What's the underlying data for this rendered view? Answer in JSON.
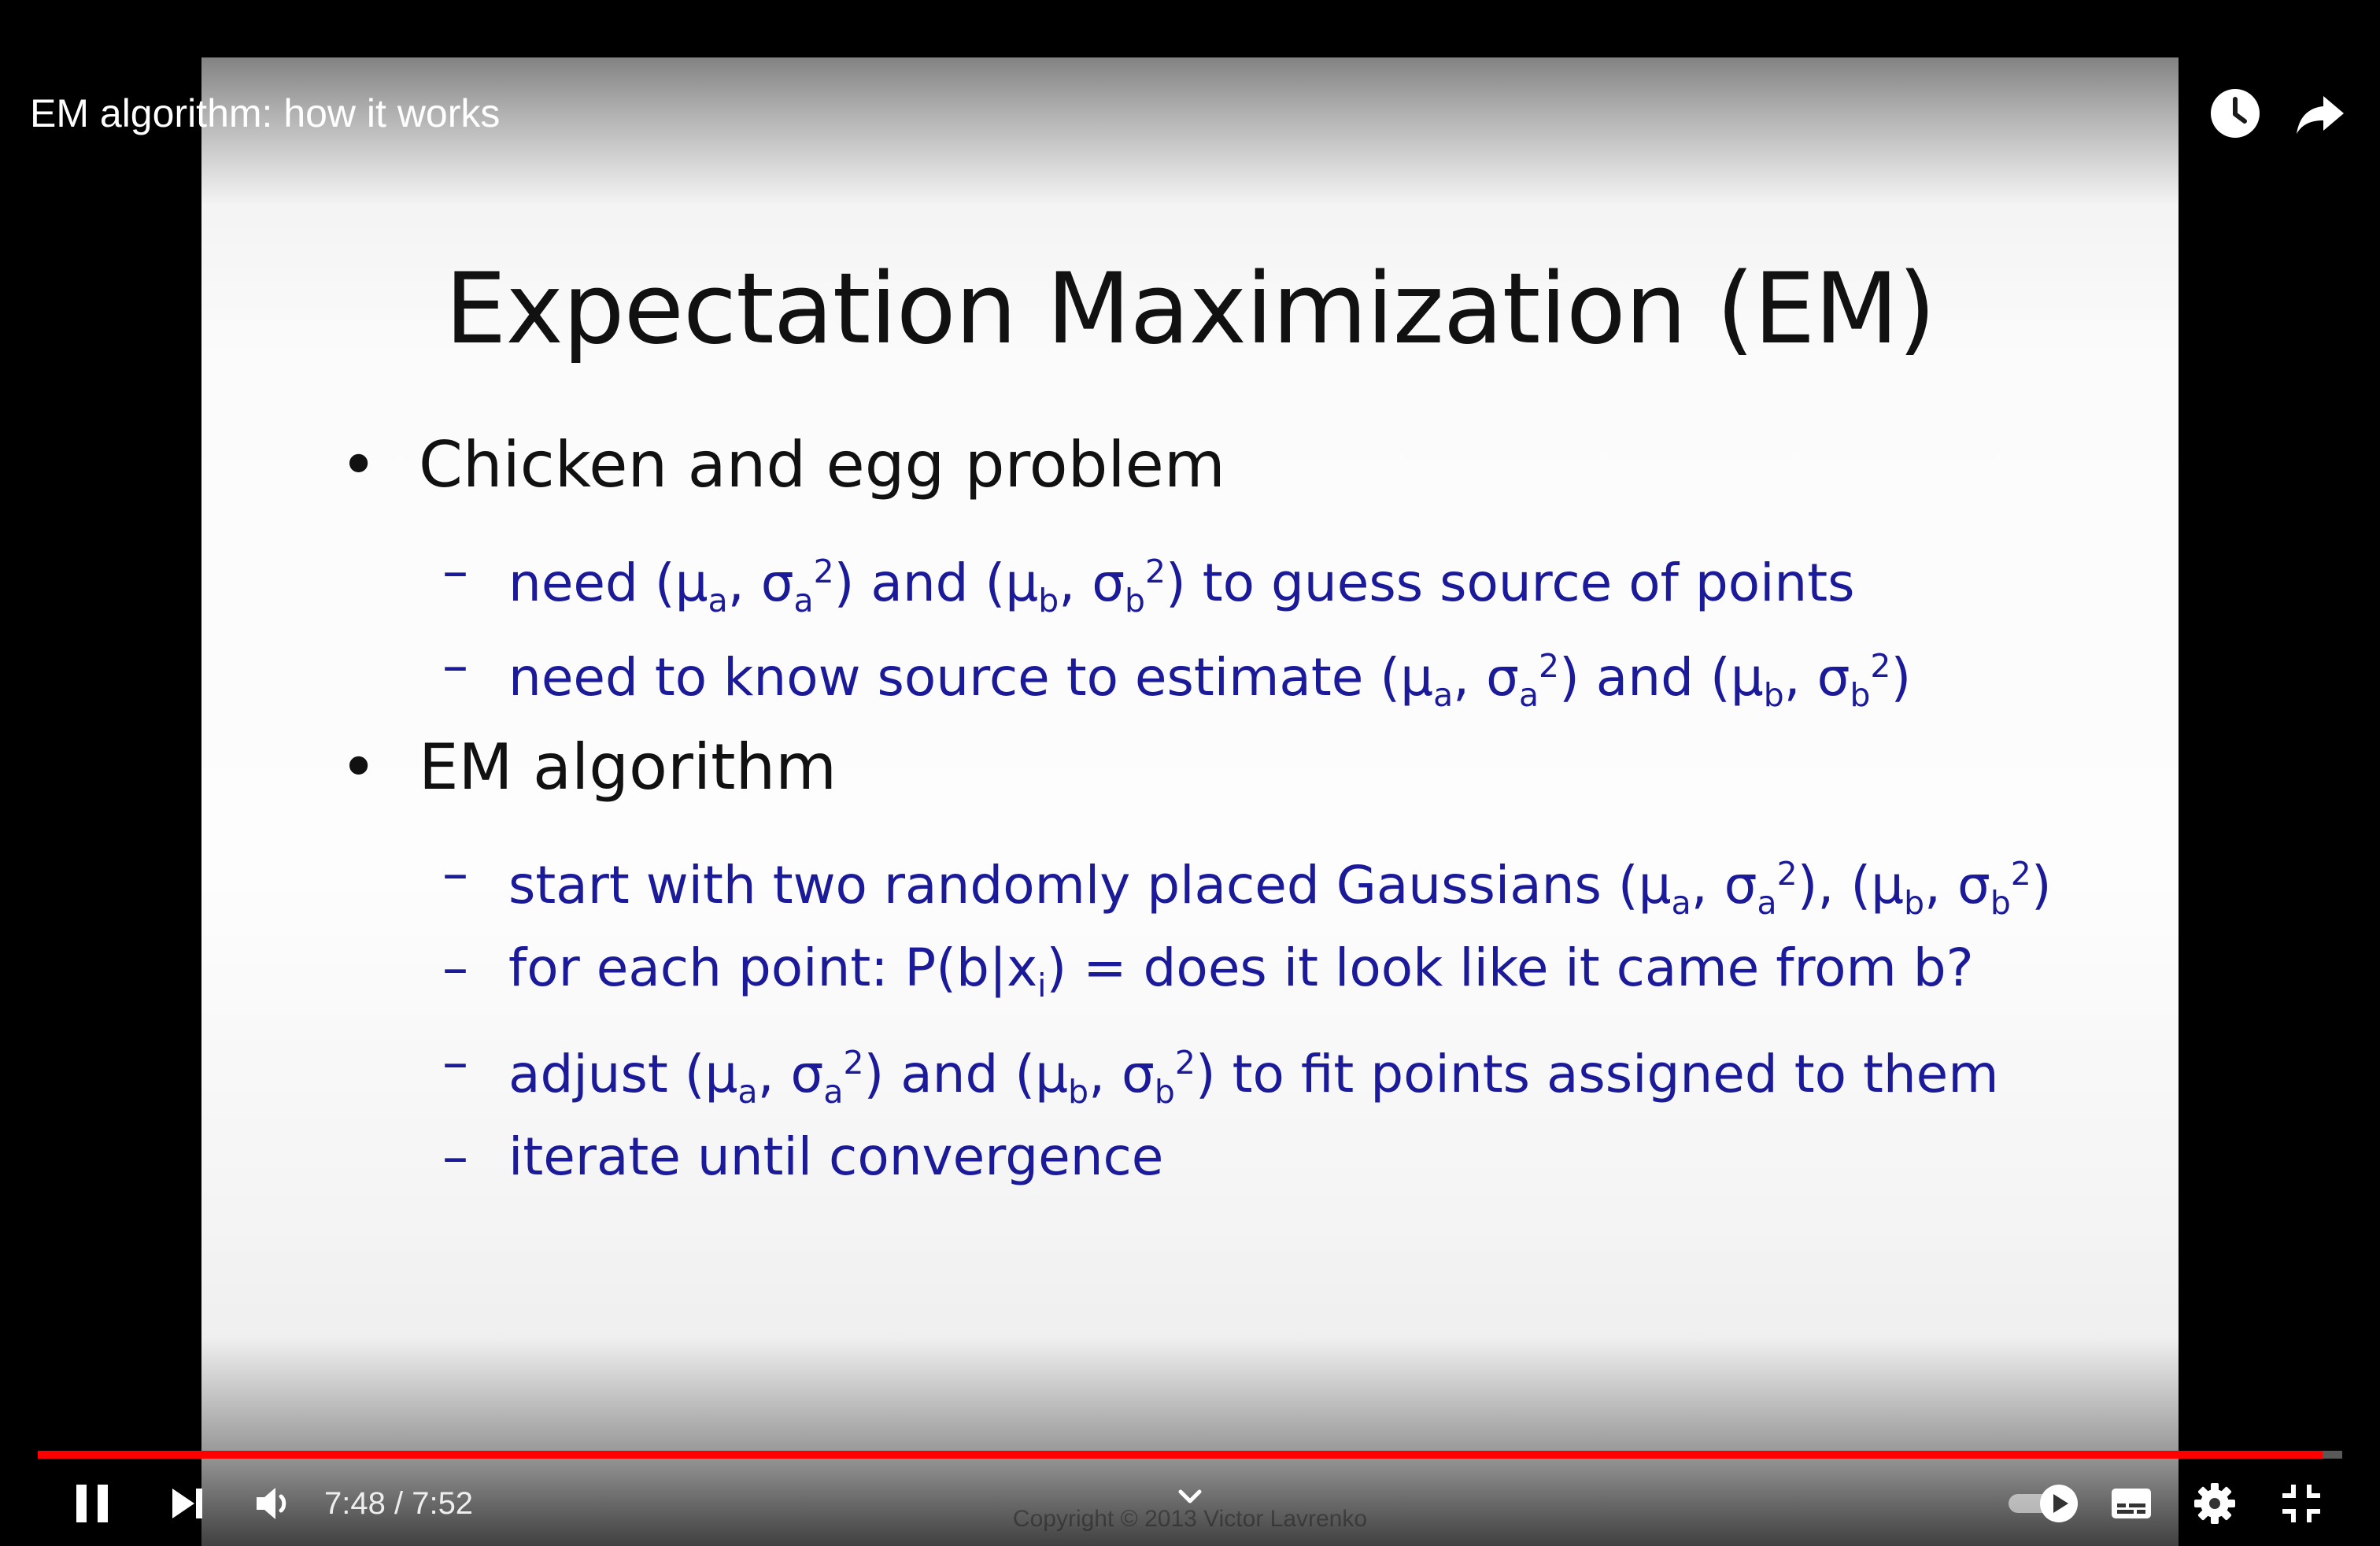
{
  "video": {
    "title": "EM algorithm: how it works"
  },
  "slide": {
    "title": "Expectation Maximization (EM)",
    "bullet_marker": "•",
    "sub_marker": "–",
    "bullets": [
      {
        "text": "Chicken and egg problem",
        "subs": [
          "need (μa, σa2) and (μb, σb2) to guess source of points",
          "need to know source to estimate (μa, σa2) and (μb, σb2)"
        ]
      },
      {
        "text": "EM algorithm",
        "subs": [
          "start with two randomly placed Gaussians (μa, σa2), (μb, σb2)",
          "for each point: P(b|xi) = does it look like it came from b?",
          "adjust (μa, σa2) and (μb, σb2) to fit points assigned to them",
          "iterate until convergence"
        ]
      }
    ],
    "copyright": "Copyright © 2013 Victor Lavrenko"
  },
  "player": {
    "current_time": "7:48",
    "duration": "7:52",
    "time_separator": " / ",
    "progress_fraction": 0.9915,
    "accent_color": "#ff0000",
    "icons": {
      "play_pause": "pause-icon",
      "next": "next-icon",
      "volume": "volume-icon",
      "chevron": "chevron-down-icon",
      "autoplay": "autoplay-toggle-icon",
      "subtitles": "subtitles-icon",
      "settings": "gear-icon",
      "exit_fullscreen": "exit-fullscreen-icon",
      "watch_later": "clock-icon",
      "share": "share-icon"
    }
  }
}
